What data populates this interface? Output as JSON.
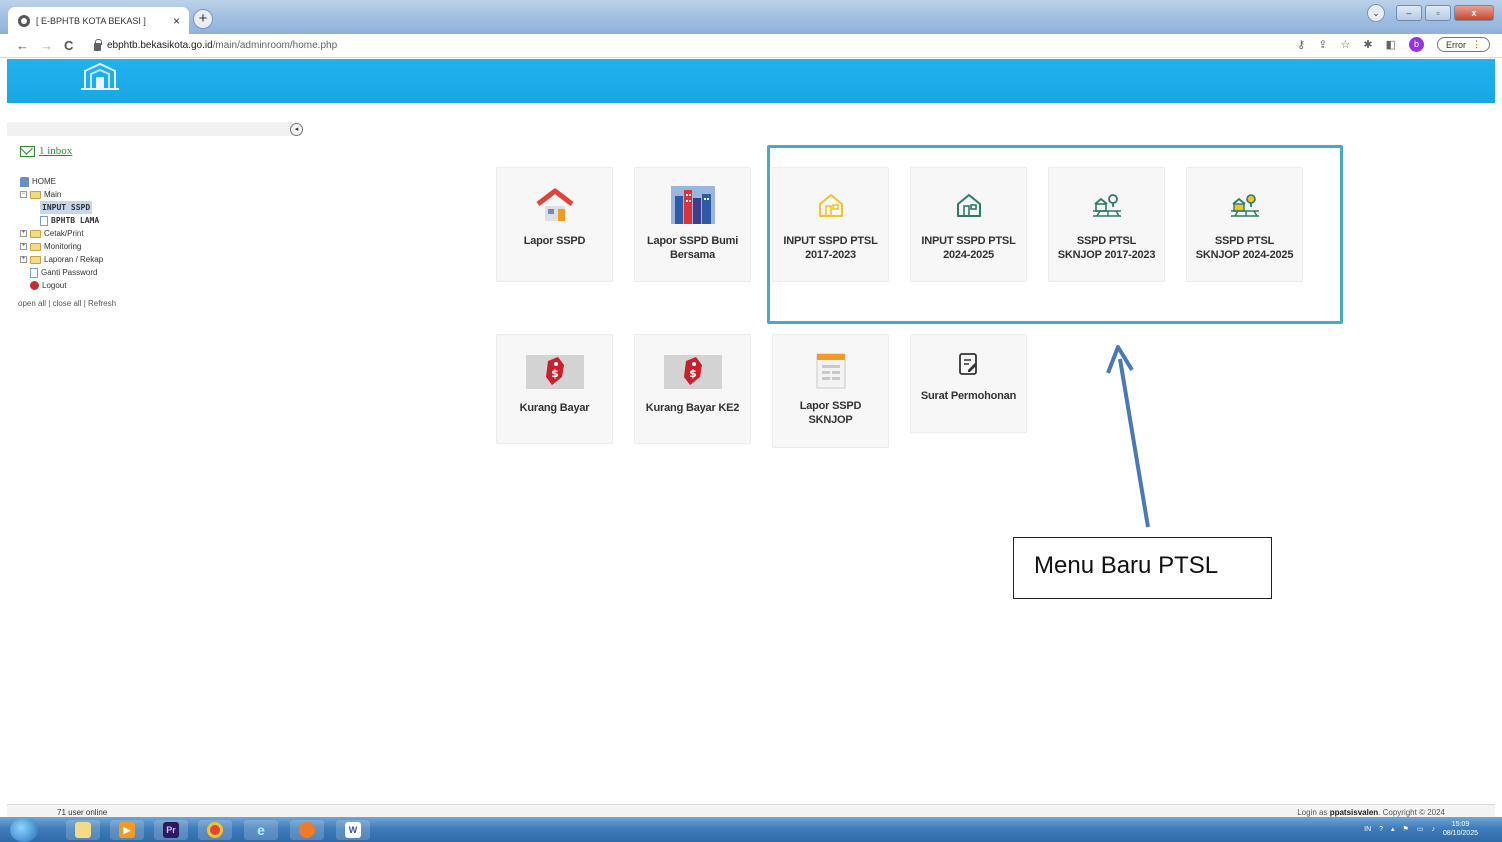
{
  "browser": {
    "tab_title": "[ E-BPHTB KOTA BEKASI ]",
    "tab_close": "×",
    "new_tab": "+",
    "back": "←",
    "forward": "→",
    "reload": "C",
    "url_domain": "ebphtb.bekasikota.go.id",
    "url_path": "/main/adminroom/home.php",
    "profile_initial": "b",
    "error_label": "Error",
    "error_menu": "⋮"
  },
  "sidebar": {
    "toggle_glyph": "◂",
    "inbox_text": "1 inbox",
    "tree": {
      "home": "HOME",
      "main": "Main",
      "input_sspd": "INPUT SSPD",
      "bphtb_lama": "BPHTB LAMA",
      "cetak": "Cetak/Print",
      "monitoring": "Monitoring",
      "laporan": "Laporan / Rekap",
      "ganti_password": "Ganti Password",
      "logout": "Logout"
    },
    "links": {
      "open_all": "open all",
      "close_all": "close all",
      "refresh": "Refresh",
      "sep": " | "
    }
  },
  "menu": {
    "lapor_sspd": "Lapor SSPD",
    "lapor_bumi_bersama": "Lapor SSPD Bumi Bersama",
    "input_ptsl_2017": "INPUT SSPD PTSL 2017-2023",
    "input_ptsl_2024": "INPUT SSPD PTSL 2024-2025",
    "skjop_2017": "SSPD PTSL SKNJOP 2017-2023",
    "skjop_2024": "SSPD PTSL SKNJOP 2024-2025",
    "kurang_bayar": "Kurang Bayar",
    "kurang_bayar_ke2": "Kurang Bayar KE2",
    "lapor_skjop": "Lapor SSPD SKNJOP",
    "surat_permohonan": "Surat Permohonan"
  },
  "annotation": {
    "callout": "Menu Baru PTSL"
  },
  "status": {
    "online": "71 user online",
    "login_prefix": "Login as ",
    "username": "ppatsisvalen",
    "copyright": ". Copyright © 2024"
  },
  "taskbar": {
    "lang": "IN",
    "time": "15:09",
    "date": "08/10/2025"
  },
  "colors": {
    "header": "#1fb3ee",
    "highlight": "#4aa7c5",
    "inbox": "#2e8b2e"
  }
}
